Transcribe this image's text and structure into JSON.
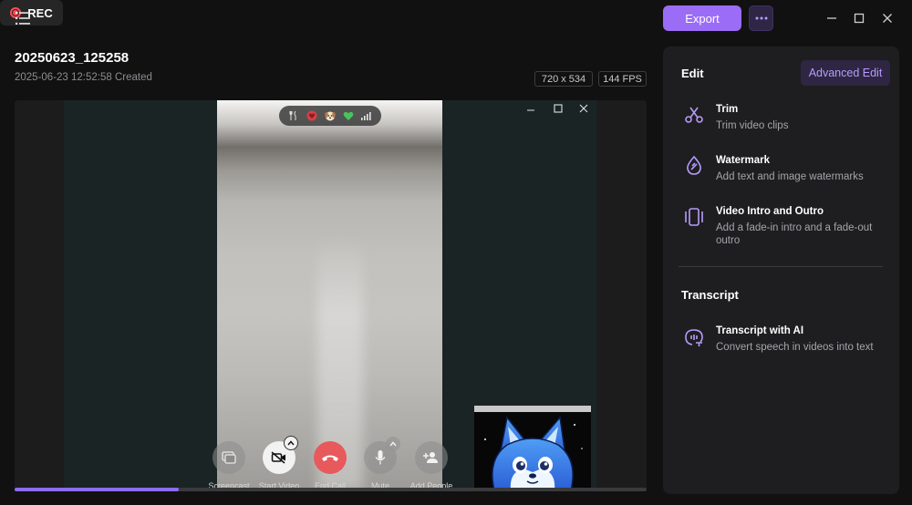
{
  "toolbar": {
    "rec_label": "REC",
    "export_label": "Export"
  },
  "file": {
    "title": "20250623_125258",
    "created": "2025-06-23 12:52:58 Created",
    "resolution": "720 x 534",
    "fps": "144 FPS"
  },
  "call": {
    "buttons": [
      {
        "label": "Screencast"
      },
      {
        "label": "Start Video"
      },
      {
        "label": "End Call"
      },
      {
        "label": "Mute"
      },
      {
        "label": "Add People"
      }
    ]
  },
  "playback": {
    "progress_percent": 26
  },
  "panel": {
    "edit_title": "Edit",
    "advanced_edit_label": "Advanced Edit",
    "tools": [
      {
        "name": "Trim",
        "desc": "Trim video clips",
        "icon": "scissors-icon"
      },
      {
        "name": "Watermark",
        "desc": "Add text and image watermarks",
        "icon": "watermark-drop-icon"
      },
      {
        "name": "Video Intro and Outro",
        "desc": "Add a fade-in intro and a fade-out outro",
        "icon": "intro-outro-icon"
      }
    ],
    "transcript_title": "Transcript",
    "transcript_tool": {
      "name": "Transcript with AI",
      "desc": "Convert speech in videos into text",
      "icon": "ai-transcript-icon"
    }
  },
  "colors": {
    "accent": "#9b6cf5",
    "record_red": "#ff4d55",
    "end_call_red": "#e8595b",
    "icon_purple": "#b79bfb"
  }
}
